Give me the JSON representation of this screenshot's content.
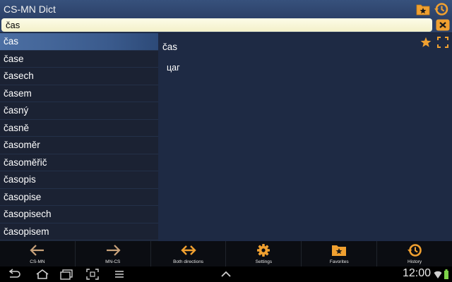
{
  "app": {
    "title": "CS-MN Dict"
  },
  "search": {
    "value": "čas"
  },
  "word_list": [
    "čas",
    "čase",
    "časech",
    "časem",
    "časný",
    "časně",
    "časoměr",
    "časoměřič",
    "časopis",
    "časopise",
    "časopisech",
    "časopisem"
  ],
  "selected_index": 0,
  "detail": {
    "headword": "čas",
    "translation": "цаг"
  },
  "toolbar": {
    "items": [
      {
        "label": "CS-MN",
        "icon": "arrow-left-icon"
      },
      {
        "label": "MN-CS",
        "icon": "arrow-right-icon"
      },
      {
        "label": "Both directions",
        "icon": "arrow-both-icon"
      },
      {
        "label": "Settings",
        "icon": "gear-icon"
      },
      {
        "label": "Favorites",
        "icon": "favorites-folder-icon"
      },
      {
        "label": "History",
        "icon": "history-icon"
      }
    ]
  },
  "system": {
    "time": "12:00"
  },
  "colors": {
    "accent_orange": "#f0a030",
    "title_bar": "#2c4168",
    "list_bg": "#1b2233",
    "selected_row": "#4c6fa3"
  }
}
